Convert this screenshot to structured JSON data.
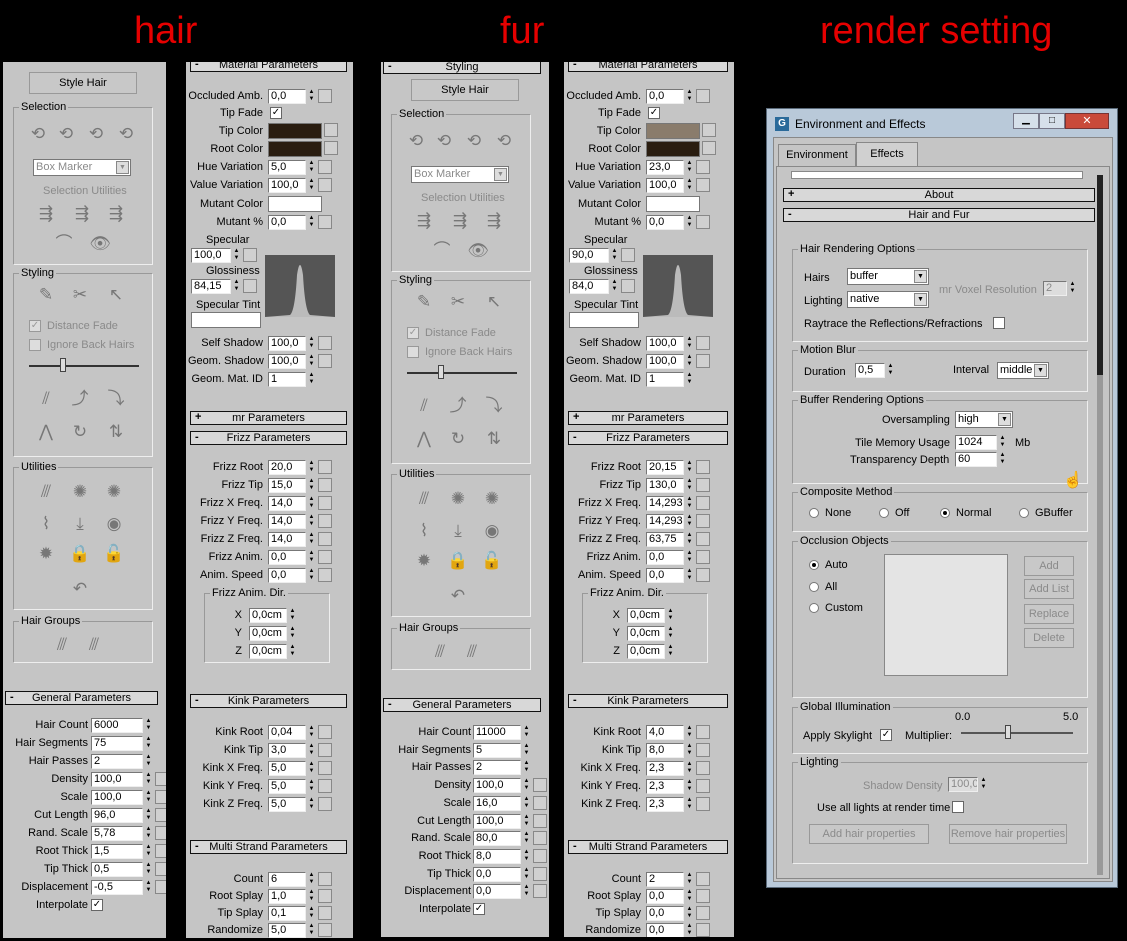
{
  "titles": {
    "hair": "hair",
    "fur": "fur",
    "render": "render setting"
  },
  "common": {
    "style_hair": "Style Hair",
    "styling_rb": "Styling",
    "selection": "Selection",
    "box_marker": "Box Marker",
    "selection_utilities": "Selection Utilities",
    "styling": "Styling",
    "distance_fade": "Distance Fade",
    "ignore_back_hairs": "Ignore Back Hairs",
    "utilities": "Utilities",
    "hair_groups": "Hair Groups",
    "general_params": "General Parameters",
    "hair_count": "Hair Count",
    "hair_segments": "Hair Segments",
    "hair_passes": "Hair Passes",
    "density": "Density",
    "scale": "Scale",
    "cut_length": "Cut Length",
    "rand_scale": "Rand. Scale",
    "root_thick": "Root Thick",
    "tip_thick": "Tip Thick",
    "displacement": "Displacement",
    "interpolate": "Interpolate",
    "material_params": "Material Parameters",
    "occluded_amb": "Occluded Amb.",
    "tip_fade": "Tip Fade",
    "tip_color": "Tip Color",
    "root_color": "Root Color",
    "hue_variation": "Hue Variation",
    "value_variation": "Value Variation",
    "mutant_color": "Mutant Color",
    "mutant_pct": "Mutant %",
    "specular": "Specular",
    "glossiness": "Glossiness",
    "specular_tint": "Specular Tint",
    "self_shadow": "Self Shadow",
    "geom_shadow": "Geom. Shadow",
    "geom_mat_id": "Geom. Mat. ID",
    "mr_params": "mr Parameters",
    "frizz_params": "Frizz Parameters",
    "frizz_root": "Frizz Root",
    "frizz_tip": "Frizz Tip",
    "frizz_x": "Frizz X Freq.",
    "frizz_y": "Frizz Y Freq.",
    "frizz_z": "Frizz Z Freq.",
    "frizz_anim": "Frizz Anim.",
    "anim_speed": "Anim. Speed",
    "frizz_anim_dir": "Frizz Anim. Dir.",
    "x": "X",
    "y": "Y",
    "z": "Z",
    "kink_params": "Kink Parameters",
    "kink_root": "Kink Root",
    "kink_tip": "Kink Tip",
    "kink_x": "Kink X Freq.",
    "kink_y": "Kink Y Freq.",
    "kink_z": "Kink Z Freq.",
    "multi_strand": "Multi Strand Parameters",
    "count": "Count",
    "root_splay": "Root Splay",
    "tip_splay": "Tip Splay",
    "randomize": "Randomize",
    "plus": "+",
    "minus": "-"
  },
  "hair": {
    "general": {
      "hair_count": "6000",
      "hair_segments": "75",
      "hair_passes": "2",
      "density": "100,0",
      "scale": "100,0",
      "cut_length": "96,0",
      "rand_scale": "5,78",
      "root_thick": "1,5",
      "tip_thick": "0,5",
      "displacement": "-0,5"
    },
    "material": {
      "occluded_amb": "0,0",
      "hue_variation": "5,0",
      "value_variation": "100,0",
      "mutant_pct": "0,0",
      "specular": "100,0",
      "glossiness": "84,15",
      "self_shadow": "100,0",
      "geom_shadow": "100,0",
      "geom_mat_id": "1",
      "tip_color": "#2a1d10",
      "root_color": "#2a1d10"
    },
    "frizz": {
      "root": "20,0",
      "tip": "15,0",
      "x": "14,0",
      "y": "14,0",
      "z": "14,0",
      "anim": "0,0",
      "speed": "0,0",
      "dx": "0,0cm",
      "dy": "0,0cm",
      "dz": "0,0cm"
    },
    "kink": {
      "root": "0,04",
      "tip": "3,0",
      "x": "5,0",
      "y": "5,0",
      "z": "5,0"
    },
    "multi": {
      "count": "6",
      "root_splay": "1,0",
      "tip_splay": "0,1",
      "randomize": "5,0"
    }
  },
  "fur": {
    "general": {
      "hair_count": "11000",
      "hair_segments": "5",
      "hair_passes": "2",
      "density": "100,0",
      "scale": "16,0",
      "cut_length": "100,0",
      "rand_scale": "80,0",
      "root_thick": "8,0",
      "tip_thick": "0,0",
      "displacement": "0,0"
    },
    "material": {
      "occluded_amb": "0,0",
      "hue_variation": "23,0",
      "value_variation": "100,0",
      "mutant_pct": "0,0",
      "specular": "90,0",
      "glossiness": "84,0",
      "self_shadow": "100,0",
      "geom_shadow": "100,0",
      "geom_mat_id": "1",
      "tip_color": "#8a7c6c",
      "root_color": "#2a1d10"
    },
    "frizz": {
      "root": "20,15",
      "tip": "130,0",
      "x": "14,293",
      "y": "14,293",
      "z": "63,75",
      "anim": "0,0",
      "speed": "0,0",
      "dx": "0,0cm",
      "dy": "0,0cm",
      "dz": "0,0cm"
    },
    "kink": {
      "root": "4,0",
      "tip": "8,0",
      "x": "2,3",
      "y": "2,3",
      "z": "2,3"
    },
    "multi": {
      "count": "2",
      "root_splay": "0,0",
      "tip_splay": "0,0",
      "randomize": "0,0"
    }
  },
  "env": {
    "window_title": "Environment and Effects",
    "tab_environment": "Environment",
    "tab_effects": "Effects",
    "about": "About",
    "hair_and_fur": "Hair and Fur",
    "hro": "Hair Rendering Options",
    "hairs": "Hairs",
    "hairs_val": "buffer",
    "lighting": "Lighting",
    "lighting_val": "native",
    "mr_voxel": "mr Voxel Resolution",
    "mr_voxel_val": "2",
    "raytrace": "Raytrace the Reflections/Refractions",
    "motion_blur": "Motion Blur",
    "duration": "Duration",
    "duration_val": "0,5",
    "interval": "Interval",
    "interval_val": "middle",
    "bro": "Buffer Rendering Options",
    "oversampling": "Oversampling",
    "oversampling_val": "high",
    "tile_memory": "Tile Memory Usage",
    "tile_memory_val": "1024",
    "mb": "Mb",
    "transparency": "Transparency Depth",
    "transparency_val": "60",
    "composite": "Composite Method",
    "none": "None",
    "off": "Off",
    "normal": "Normal",
    "gbuffer": "GBuffer",
    "occlusion": "Occlusion Objects",
    "auto": "Auto",
    "all": "All",
    "custom": "Custom",
    "add": "Add",
    "add_list": "Add List",
    "replace": "Replace",
    "delete": "Delete",
    "gi": "Global Illumination",
    "gi_min": "0.0",
    "gi_max": "5.0",
    "apply_skylight": "Apply Skylight",
    "multiplier": "Multiplier:",
    "lighting_grp": "Lighting",
    "shadow_density": "Shadow Density",
    "shadow_density_val": "100,0",
    "use_all_lights": "Use all lights at render time",
    "add_hair_props": "Add hair properties",
    "remove_hair_props": "Remove hair properties"
  }
}
